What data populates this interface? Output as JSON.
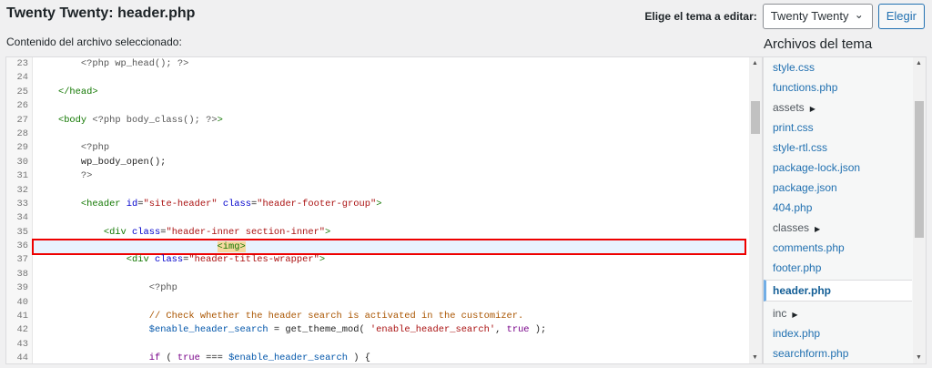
{
  "page": {
    "title": "Twenty Twenty: header.php",
    "subtitle": "Contenido del archivo seleccionado:"
  },
  "theme_picker": {
    "label": "Elige el tema a editar:",
    "selected": "Twenty Twenty",
    "button": "Elegir"
  },
  "files": {
    "title": "Archivos del tema",
    "items": [
      {
        "label": "style.css",
        "type": "file"
      },
      {
        "label": "functions.php",
        "type": "file"
      },
      {
        "label": "assets",
        "type": "folder"
      },
      {
        "label": "print.css",
        "type": "file"
      },
      {
        "label": "style-rtl.css",
        "type": "file"
      },
      {
        "label": "package-lock.json",
        "type": "file"
      },
      {
        "label": "package.json",
        "type": "file"
      },
      {
        "label": "404.php",
        "type": "file"
      },
      {
        "label": "classes",
        "type": "folder"
      },
      {
        "label": "comments.php",
        "type": "file"
      },
      {
        "label": "footer.php",
        "type": "file"
      },
      {
        "label": "header.php",
        "type": "file",
        "selected": true
      },
      {
        "label": "inc",
        "type": "folder"
      },
      {
        "label": "index.php",
        "type": "file"
      },
      {
        "label": "searchform.php",
        "type": "file"
      }
    ]
  },
  "editor": {
    "highlighted_line": 36,
    "lines": [
      {
        "n": "23",
        "seg": [
          [
            "p",
            "        "
          ],
          [
            "d",
            "<?php wp_head(); ?>"
          ]
        ]
      },
      {
        "n": "24",
        "seg": []
      },
      {
        "n": "25",
        "seg": [
          [
            "p",
            "    "
          ],
          [
            "t",
            "</head>"
          ]
        ]
      },
      {
        "n": "26",
        "seg": []
      },
      {
        "n": "27",
        "seg": [
          [
            "p",
            "    "
          ],
          [
            "t",
            "<body "
          ],
          [
            "d",
            "<?php body_class(); ?>"
          ],
          [
            "t",
            ">"
          ]
        ]
      },
      {
        "n": "28",
        "seg": []
      },
      {
        "n": "29",
        "seg": [
          [
            "p",
            "        "
          ],
          [
            "d",
            "<?php"
          ]
        ]
      },
      {
        "n": "30",
        "seg": [
          [
            "p",
            "        wp_body_open();"
          ]
        ]
      },
      {
        "n": "31",
        "seg": [
          [
            "p",
            "        "
          ],
          [
            "d",
            "?>"
          ]
        ]
      },
      {
        "n": "32",
        "seg": []
      },
      {
        "n": "33",
        "seg": [
          [
            "p",
            "        "
          ],
          [
            "t",
            "<header "
          ],
          [
            "a",
            "id"
          ],
          [
            "p",
            "="
          ],
          [
            "s",
            "\"site-header\""
          ],
          [
            "p",
            " "
          ],
          [
            "a",
            "class"
          ],
          [
            "p",
            "="
          ],
          [
            "s",
            "\"header-footer-group\""
          ],
          [
            "t",
            ">"
          ]
        ]
      },
      {
        "n": "34",
        "seg": []
      },
      {
        "n": "35",
        "seg": [
          [
            "p",
            "            "
          ],
          [
            "t",
            "<div "
          ],
          [
            "a",
            "class"
          ],
          [
            "p",
            "="
          ],
          [
            "s",
            "\"header-inner section-inner\""
          ],
          [
            "t",
            ">"
          ]
        ]
      },
      {
        "n": "36",
        "seg": [
          [
            "p",
            "                                "
          ],
          [
            "h",
            "<img>"
          ]
        ]
      },
      {
        "n": "37",
        "seg": [
          [
            "p",
            "                "
          ],
          [
            "t",
            "<div "
          ],
          [
            "a",
            "class"
          ],
          [
            "p",
            "="
          ],
          [
            "s",
            "\"header-titles-wrapper\""
          ],
          [
            "t",
            ">"
          ]
        ]
      },
      {
        "n": "38",
        "seg": []
      },
      {
        "n": "39",
        "seg": [
          [
            "p",
            "                    "
          ],
          [
            "d",
            "<?php"
          ]
        ]
      },
      {
        "n": "40",
        "seg": []
      },
      {
        "n": "41",
        "seg": [
          [
            "p",
            "                    "
          ],
          [
            "c",
            "// Check whether the header search is activated in the customizer."
          ]
        ]
      },
      {
        "n": "42",
        "seg": [
          [
            "p",
            "                    "
          ],
          [
            "v",
            "$enable_header_search"
          ],
          [
            "p",
            " = get_theme_mod( "
          ],
          [
            "s",
            "'enable_header_search'"
          ],
          [
            "p",
            ", "
          ],
          [
            "k",
            "true"
          ],
          [
            "p",
            " );"
          ]
        ]
      },
      {
        "n": "43",
        "seg": []
      },
      {
        "n": "44",
        "seg": [
          [
            "p",
            "                    "
          ],
          [
            "k",
            "if"
          ],
          [
            "p",
            " ( "
          ],
          [
            "k",
            "true"
          ],
          [
            "p",
            " === "
          ],
          [
            "v",
            "$enable_header_search"
          ],
          [
            "p",
            " ) {"
          ]
        ]
      }
    ]
  }
}
